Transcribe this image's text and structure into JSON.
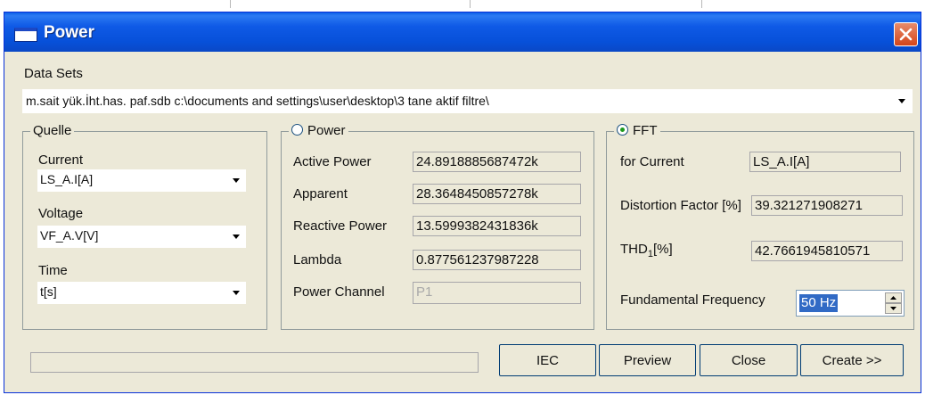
{
  "window": {
    "title": "Power"
  },
  "datasets": {
    "label": "Data Sets",
    "value": "m.sait yük.İht.has. paf.sdb c:\\documents and settings\\user\\desktop\\3 tane aktif filtre\\"
  },
  "quelle": {
    "legend": "Quelle",
    "current_label": "Current",
    "current_value": "LS_A.I[A]",
    "voltage_label": "Voltage",
    "voltage_value": "VF_A.V[V]",
    "time_label": "Time",
    "time_value": "t[s]"
  },
  "power": {
    "legend": "Power",
    "selected": false,
    "active_label": "Active Power",
    "active_value": "24.8918885687472k",
    "apparent_label": "Apparent",
    "apparent_value": "28.3648450857278k",
    "reactive_label": "Reactive Power",
    "reactive_value": "13.5999382431836k",
    "lambda_label": "Lambda",
    "lambda_value": "0.877561237987228",
    "channel_label": "Power Channel",
    "channel_value": "P1"
  },
  "fft": {
    "legend": "FFT",
    "selected": true,
    "current_label": "for Current",
    "current_value": "LS_A.I[A]",
    "distortion_label": "Distortion Factor [%]",
    "distortion_value": "39.321271908271",
    "thd_label": "THD",
    "thd_sub": "1",
    "thd_suffix": "[%]",
    "thd_value": "42.7661945810571",
    "freq_label": "Fundamental Frequency",
    "freq_value": "50 Hz"
  },
  "buttons": {
    "iec": "IEC",
    "preview": "Preview",
    "close": "Close",
    "create": "Create >>"
  },
  "colors": {
    "titlebar": "#0a5fe8",
    "face": "#ece9d8",
    "close_button": "#d4451a",
    "selection": "#316ac5"
  },
  "icons": {
    "close": "close-icon",
    "dropdown": "chevron-down-icon",
    "spin_up": "spin-up-icon",
    "spin_down": "spin-down-icon",
    "window": "window-icon"
  }
}
